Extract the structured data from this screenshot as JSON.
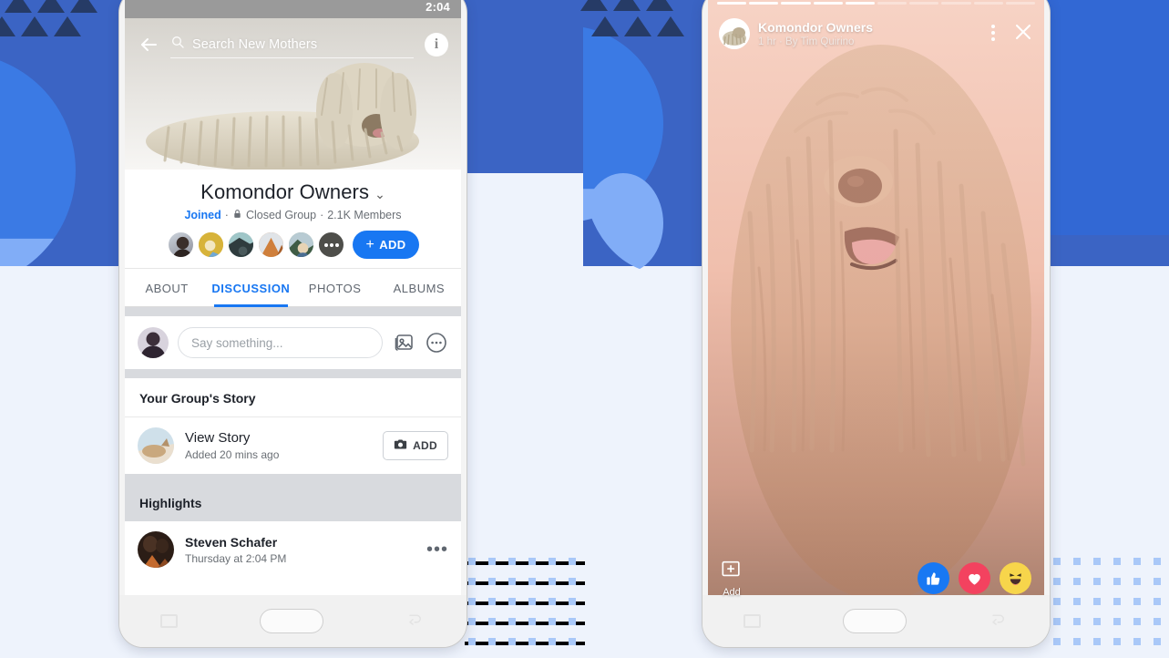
{
  "background": {
    "band_color": "#3b64c4",
    "band_right_color": "#3268d4",
    "light_color": "#eef3fc",
    "circle_color": "#3b7ae4",
    "circle_light_color": "#81adf7",
    "triangle_color": "#263b66",
    "dot_color": "#a9c8f8"
  },
  "left_phone": {
    "status_bar": {
      "time": "2:04"
    },
    "search": {
      "back_icon": "back-arrow-icon",
      "search_icon": "search-icon",
      "placeholder": "Search New Mothers",
      "info_icon": "info-icon",
      "info_label": "i"
    },
    "cover_image_alt": "komondor-dog-photo",
    "group": {
      "title": "Komondor Owners",
      "chevron": "⌄",
      "status": "Joined",
      "sep1": "·",
      "lock_icon": "lock-icon",
      "privacy": "Closed Group",
      "sep2": "·",
      "members": "2.1K Members",
      "add_button": "ADD",
      "add_plus": "+",
      "member_avatars": [
        {
          "name": "member-avatar-1",
          "color": "#8a8f9a"
        },
        {
          "name": "member-avatar-2",
          "color": "#d7b33a"
        },
        {
          "name": "member-avatar-3",
          "color": "#5d7f85"
        },
        {
          "name": "member-avatar-4",
          "color": "#c07a3c"
        },
        {
          "name": "member-avatar-5",
          "color": "#7d8d7a"
        },
        {
          "name": "member-avatar-more",
          "color": "#4e4e4a"
        }
      ]
    },
    "tabs": [
      {
        "label": "ABOUT",
        "active": false
      },
      {
        "label": "DISCUSSION",
        "active": true
      },
      {
        "label": "PHOTOS",
        "active": false
      },
      {
        "label": "ALBUMS",
        "active": false
      }
    ],
    "composer": {
      "avatar_name": "user-avatar",
      "placeholder": "Say something...",
      "photo_icon": "photo-icon",
      "more_icon": "more-options-icon"
    },
    "group_story": {
      "section_title": "Your Group's Story",
      "title": "View Story",
      "subtitle": "Added 20 mins ago",
      "add_button": "ADD",
      "camera_icon": "camera-icon"
    },
    "highlights": {
      "section_title": "Highlights",
      "post_author": "Steven Schafer",
      "post_time": "Thursday at 2:04 PM",
      "more_icon": "more-options-icon"
    },
    "nav": {
      "recents_icon": "recents-icon",
      "home_icon": "home-button",
      "back_icon": "back-nav-icon"
    }
  },
  "right_phone": {
    "story": {
      "progress_total": 10,
      "progress_filled": 5,
      "avatar_name": "group-avatar",
      "title": "Komondor Owners",
      "subtitle": "1 hr · By Tim Quirino",
      "kebab_icon": "more-options-icon",
      "close_icon": "close-icon",
      "image_alt": "komondor-dog-closeup",
      "add_label": "Add",
      "add_icon": "add-to-story-icon",
      "reactions": [
        {
          "name": "reaction-like",
          "glyph": "👍",
          "color": "#1878f3"
        },
        {
          "name": "reaction-love",
          "glyph": "♥",
          "color": "#f3425f"
        },
        {
          "name": "reaction-haha",
          "glyph": "😆",
          "color": "#f7d54b"
        }
      ]
    },
    "nav": {
      "recents_icon": "recents-icon",
      "home_icon": "home-button",
      "back_icon": "back-nav-icon"
    }
  }
}
